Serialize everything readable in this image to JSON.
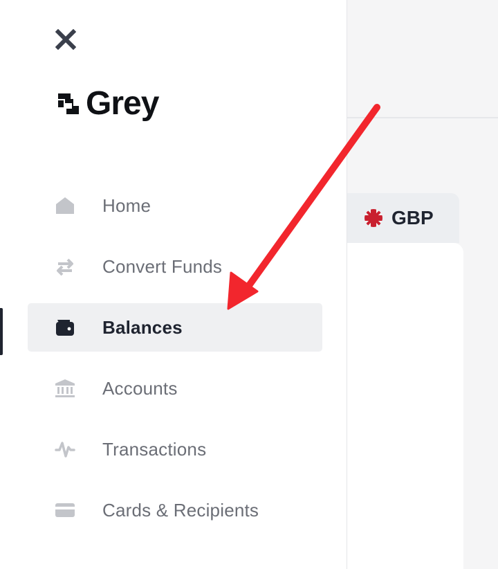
{
  "brand": {
    "name": "Grey"
  },
  "nav": {
    "items": [
      {
        "label": "Home",
        "icon": "home-icon",
        "active": false
      },
      {
        "label": "Convert Funds",
        "icon": "convert-icon",
        "active": false
      },
      {
        "label": "Balances",
        "icon": "wallet-icon",
        "active": true
      },
      {
        "label": "Accounts",
        "icon": "bank-icon",
        "active": false
      },
      {
        "label": "Transactions",
        "icon": "activity-icon",
        "active": false
      },
      {
        "label": "Cards & Recipients",
        "icon": "card-icon",
        "active": false
      }
    ]
  },
  "background": {
    "currency_tab": {
      "code": "GBP",
      "flag": "uk-flag-icon"
    }
  },
  "colors": {
    "active_text": "#1f2430",
    "inactive_text": "#6b6e76",
    "active_bg": "#eff0f2",
    "annotation_arrow": "#f2262d"
  }
}
